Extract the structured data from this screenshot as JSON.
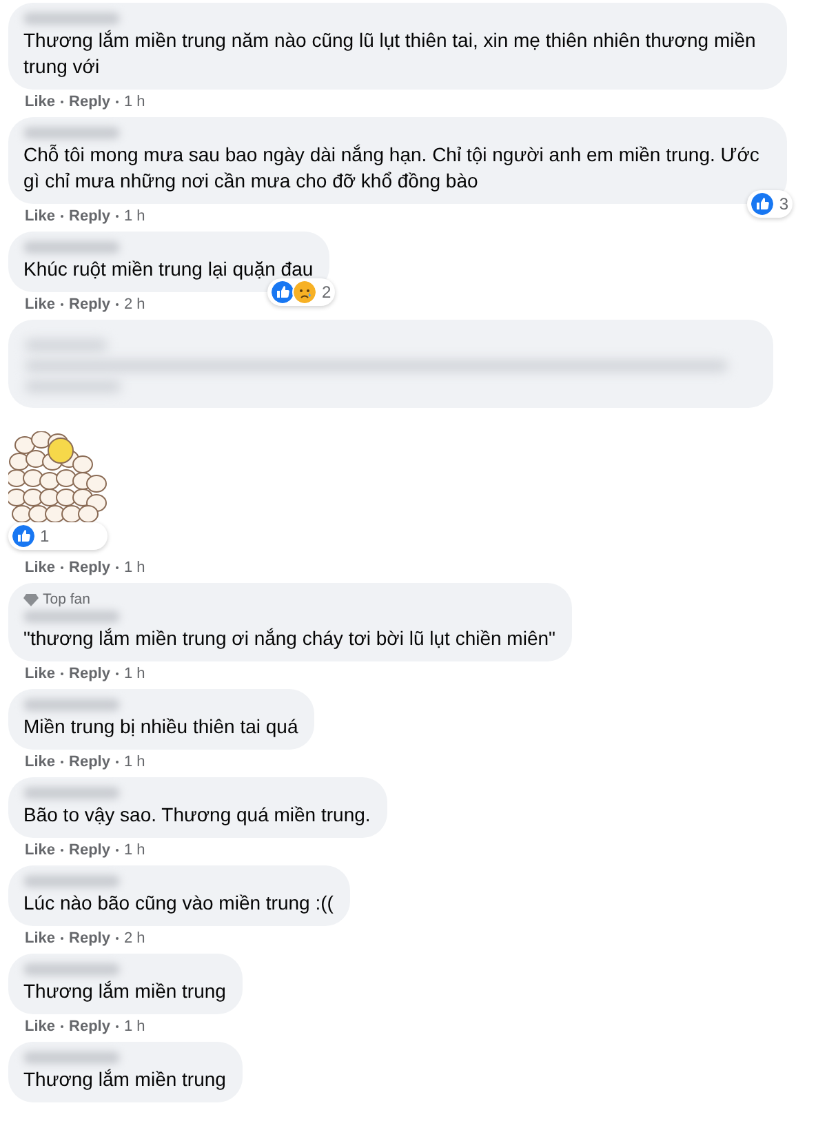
{
  "comments": [
    {
      "kind": "text",
      "text": "Thương lắm miền trung năm nào cũng lũ lụt thiên tai, xin mẹ thiên nhiên thương miền trung với",
      "actions": {
        "like": "Like",
        "reply": "Reply",
        "time": "1 h"
      }
    },
    {
      "kind": "text",
      "text": "Chỗ tôi mong mưa sau bao ngày dài nắng hạn. Chỉ tội người anh em miền trung. Ước gì chỉ mưa những nơi cần mưa cho đỡ khổ đồng bào",
      "reactions": {
        "icons": [
          {
            "kind": "like"
          }
        ],
        "count": "3"
      },
      "actions": {
        "like": "Like",
        "reply": "Reply",
        "time": "1 h"
      }
    },
    {
      "kind": "text",
      "text": "Khúc ruột miền trung lại quặn đau",
      "reactions": {
        "icons": [
          {
            "kind": "like"
          },
          {
            "kind": "sad"
          }
        ],
        "count": "2"
      },
      "actions": {
        "like": "Like",
        "reply": "Reply",
        "time": "2 h"
      }
    },
    {
      "kind": "blurred"
    },
    {
      "kind": "sticker",
      "reactions": {
        "icons": [
          {
            "kind": "like"
          }
        ],
        "count": "1"
      },
      "actions": {
        "like": "Like",
        "reply": "Reply",
        "time": "1 h"
      }
    },
    {
      "kind": "text",
      "top_fan": "Top fan",
      "text": "\"thương lắm miền trung ơi nắng cháy tơi bời lũ lụt chiền miên\"",
      "actions": {
        "like": "Like",
        "reply": "Reply",
        "time": "1 h"
      }
    },
    {
      "kind": "text",
      "text": "Miền trung bị nhiều thiên tai quá",
      "actions": {
        "like": "Like",
        "reply": "Reply",
        "time": "1 h"
      }
    },
    {
      "kind": "text",
      "text": "Bão to vậy sao. Thương quá miền trung.",
      "actions": {
        "like": "Like",
        "reply": "Reply",
        "time": "1 h"
      }
    },
    {
      "kind": "text",
      "text": "Lúc nào bão cũng vào miền trung :((",
      "actions": {
        "like": "Like",
        "reply": "Reply",
        "time": "2 h"
      }
    },
    {
      "kind": "text",
      "text": "Thương lắm miền trung",
      "actions": {
        "like": "Like",
        "reply": "Reply",
        "time": "1 h"
      }
    },
    {
      "kind": "text",
      "text": "Thương lắm miền trung"
    }
  ]
}
